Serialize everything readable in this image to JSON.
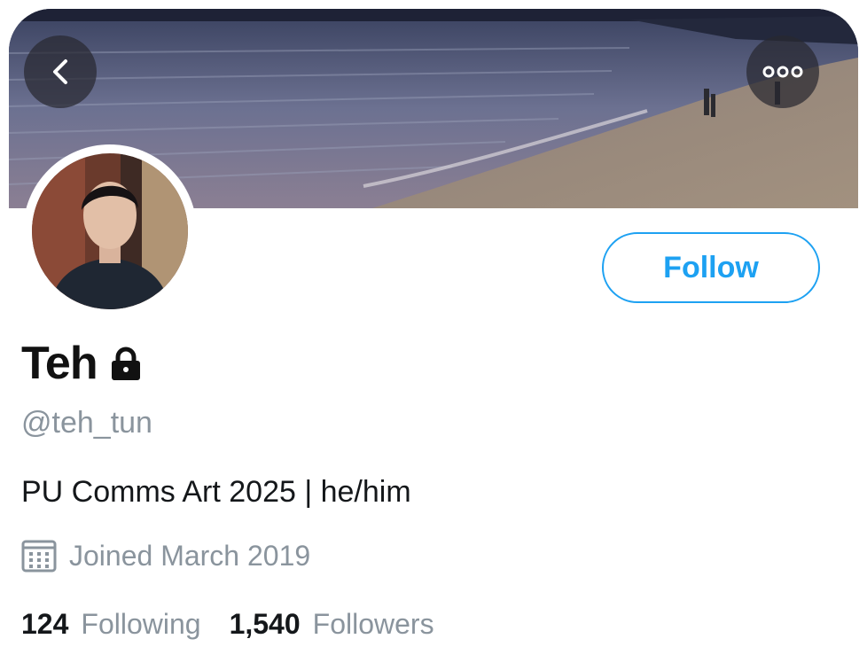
{
  "profile": {
    "name": "Teh",
    "handle": "@teh_tun",
    "bio": "PU Comms Art 2025 | he/him",
    "joined": "Joined March 2019",
    "locked": true
  },
  "actions": {
    "follow_label": "Follow",
    "back_icon": "chevron-left-icon",
    "more_icon": "more-options-icon"
  },
  "stats": {
    "following_count": "124",
    "following_label": "Following",
    "followers_count": "1,540",
    "followers_label": "Followers"
  },
  "colors": {
    "accent": "#1da1f2",
    "secondary_text": "#8a949d",
    "primary_text": "#14171a"
  }
}
